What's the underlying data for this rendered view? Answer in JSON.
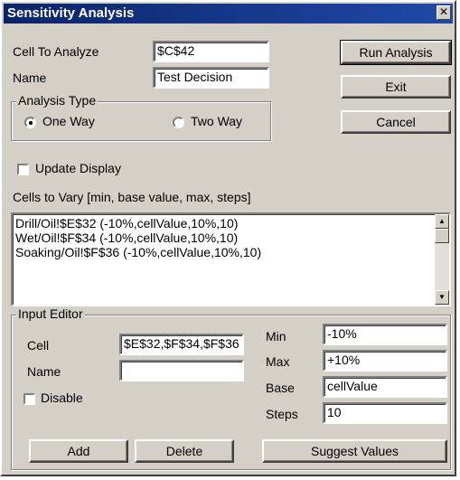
{
  "window": {
    "title": "Sensitivity Analysis",
    "close_glyph": "✕"
  },
  "top": {
    "cell_label": "Cell To Analyze",
    "cell_value": "$C$42",
    "name_label": "Name",
    "name_value": "Test Decision"
  },
  "buttons": {
    "run": "Run Analysis",
    "exit": "Exit",
    "cancel": "Cancel"
  },
  "analysis_type": {
    "legend": "Analysis Type",
    "one_way": "One Way",
    "two_way": "Two Way",
    "selected": "One Way"
  },
  "update_display": {
    "label": "Update Display",
    "checked": false
  },
  "cells_to_vary": {
    "label": "Cells to Vary [min, base value, max, steps]",
    "items": [
      "Drill/Oil!$E$32 (-10%,cellValue,10%,10)",
      "Wet/Oil!$F$34 (-10%,cellValue,10%,10)",
      "Soaking/Oil!$F$36 (-10%,cellValue,10%,10)"
    ]
  },
  "input_editor": {
    "legend": "Input Editor",
    "cell_label": "Cell",
    "cell_value": "$E$32,$F$34,$F$36",
    "name_label": "Name",
    "name_value": "",
    "disable_label": "Disable",
    "disable_checked": false,
    "min_label": "Min",
    "min_value": "-10%",
    "max_label": "Max",
    "max_value": "+10%",
    "base_label": "Base",
    "base_value": "cellValue",
    "steps_label": "Steps",
    "steps_value": "10",
    "add_label": "Add",
    "delete_label": "Delete",
    "suggest_label": "Suggest Values"
  }
}
